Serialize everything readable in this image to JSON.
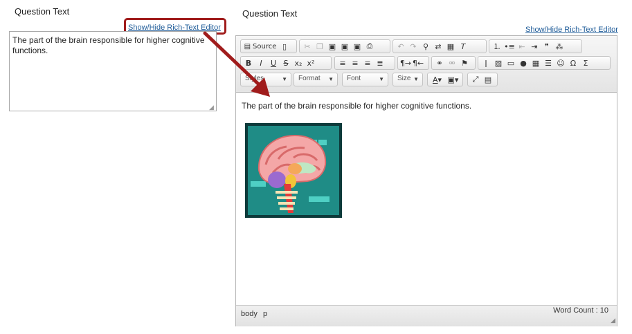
{
  "left_panel": {
    "label": "Question Text",
    "toggle_link": "Show/Hide Rich-Text Editor",
    "textarea_value": "The part of the brain responsible for higher cognitive functions."
  },
  "right_panel": {
    "label": "Question Text",
    "toggle_link": "Show/Hide Rich-Text Editor"
  },
  "toolbar": {
    "source_label": "Source",
    "styles_label": "Styles",
    "format_label": "Format",
    "font_label": "Font",
    "size_label": "Size"
  },
  "editor": {
    "content_text": "The part of the brain responsible for higher cognitive functions.",
    "path": [
      "body",
      "p"
    ],
    "word_count": "Word Count : 10"
  },
  "colors": {
    "callout": "#a01c1c",
    "link": "#1f5c99"
  }
}
